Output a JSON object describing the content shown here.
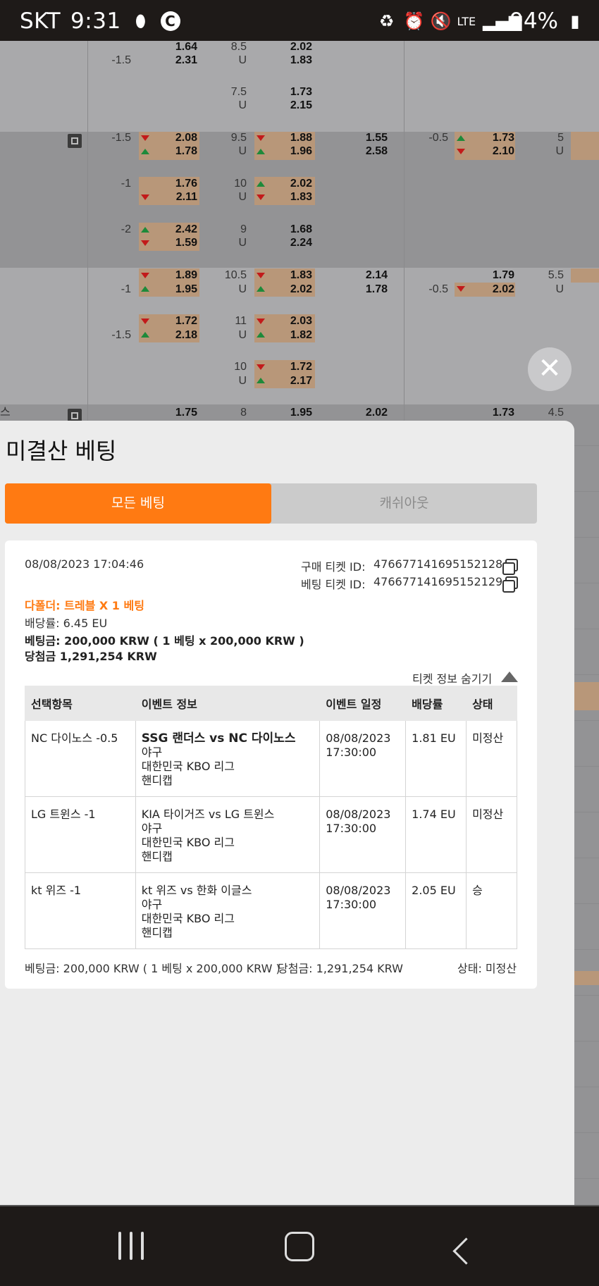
{
  "status_bar": {
    "carrier": "SKT",
    "time": "9:31",
    "battery": "94%",
    "network": "LTE"
  },
  "background_odds": {
    "rows": [
      {
        "spread": "-1.5",
        "odd1": "1.64",
        "odd2": "2.31",
        "total": "8.5",
        "total_u": "U",
        "o1": "2.02",
        "o2": "1.83"
      },
      {
        "spread": "",
        "odd1": "",
        "odd2": "",
        "total": "7.5",
        "total_u": "U",
        "o1": "1.73",
        "o2": "2.15"
      },
      {
        "spread": "-1.5",
        "odd1": "2.08",
        "odd2": "1.78",
        "total": "9.5",
        "total_u": "U",
        "o1": "1.88",
        "o2": "1.96",
        "ml1": "1.55",
        "ml2": "2.58",
        "sp2": "-0.5",
        "p1": "1.73",
        "p2": "2.10",
        "t2": "5",
        "t2u": "U"
      },
      {
        "spread": "-1",
        "odd1": "1.76",
        "odd2": "2.11",
        "total": "10",
        "total_u": "U",
        "o1": "2.02",
        "o2": "1.83"
      },
      {
        "spread": "-2",
        "odd1": "2.42",
        "odd2": "1.59",
        "total": "9",
        "total_u": "U",
        "o1": "1.68",
        "o2": "2.24"
      },
      {
        "spread": "-1",
        "odd1": "1.89",
        "odd2": "1.95",
        "total": "10.5",
        "total_u": "U",
        "o1": "1.83",
        "o2": "2.02",
        "ml1": "2.14",
        "ml2": "1.78",
        "sp2": "-0.5",
        "p1": "1.79",
        "p2": "2.02",
        "t2": "5.5",
        "t2u": "U"
      },
      {
        "spread": "-1.5",
        "odd1": "1.72",
        "odd2": "2.18",
        "total": "11",
        "total_u": "U",
        "o1": "2.03",
        "o2": "1.82"
      },
      {
        "spread": "",
        "odd1": "",
        "odd2": "",
        "total": "10",
        "total_u": "U",
        "o1": "1.72",
        "o2": "2.17"
      },
      {
        "spread": "",
        "odd1": "1.75",
        "odd2": "",
        "total": "8",
        "total_u": "",
        "o1": "1.95",
        "o2": "",
        "ml1": "2.02",
        "p1": "1.73",
        "t2": "4.5"
      }
    ],
    "partial_label": "스"
  },
  "sheet": {
    "title": "미결산 베팅",
    "tabs": {
      "all": "모든 베팅",
      "cashout": "캐쉬아웃"
    },
    "ticket": {
      "datetime": "08/08/2023 17:04:46",
      "purchase_id_label": "구매 티켓 ID:",
      "purchase_id": "476677141695152128",
      "bet_id_label": "베팅 티켓 ID:",
      "bet_id": "476677141695152129",
      "bet_type": "다폴더: 트레블 X 1 베팅",
      "odds": "배당률: 6.45 EU",
      "stake": "베팅금: 200,000 KRW ( 1 베팅 x 200,000 KRW )",
      "payout": "당첨금 1,291,254 KRW",
      "toggle_label": "티켓 정보 숨기기",
      "headers": [
        "선택항목",
        "이벤트 정보",
        "이벤트 일정",
        "배당률",
        "상태"
      ],
      "selections": [
        {
          "pick": "NC 다이노스 -0.5",
          "event": "SSG 랜더스 vs NC 다이노스",
          "event_bold": true,
          "sport": "야구",
          "league": "대한민국 KBO 리그",
          "market": "핸디캡",
          "date": "08/08/2023",
          "time": "17:30:00",
          "odds": "1.81 EU",
          "status": "미정산"
        },
        {
          "pick": "LG 트윈스 -1",
          "event": "KIA 타이거즈 vs LG 트윈스",
          "event_bold": false,
          "sport": "야구",
          "league": "대한민국 KBO 리그",
          "market": "핸디캡",
          "date": "08/08/2023",
          "time": "17:30:00",
          "odds": "1.74 EU",
          "status": "미정산"
        },
        {
          "pick": "kt 위즈 -1",
          "event": "kt 위즈 vs 한화 이글스",
          "event_bold": false,
          "sport": "야구",
          "league": "대한민국 KBO 리그",
          "market": "핸디캡",
          "date": "08/08/2023",
          "time": "17:30:00",
          "odds": "2.05 EU",
          "status": "승"
        }
      ],
      "footer_stake": "베팅금: 200,000 KRW ( 1 베팅 x 200,000 KRW )",
      "footer_payout": "당첨금: 1,291,254 KRW",
      "footer_status": "상태: 미정산"
    }
  },
  "colors": {
    "accent": "#ff7a12",
    "odds_box": "#b89779",
    "up": "#1e8a3a",
    "down": "#c21a1a"
  }
}
